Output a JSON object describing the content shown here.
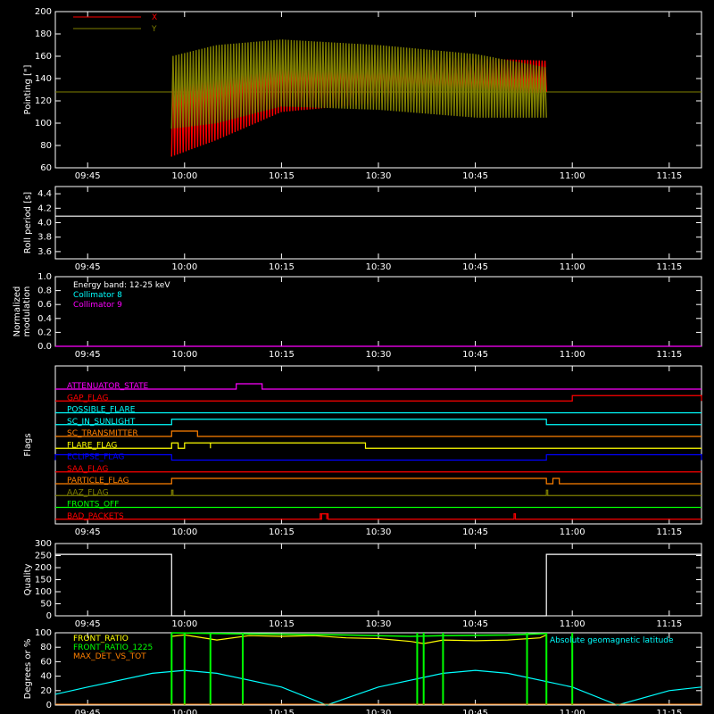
{
  "x_ticks": [
    "09:45",
    "10:00",
    "10:15",
    "10:30",
    "10:45",
    "11:00",
    "11:15"
  ],
  "chart_data": [
    {
      "type": "line",
      "ylabel": "Pointing [\"]",
      "ylim": [
        60,
        200
      ],
      "yticks": [
        60,
        80,
        100,
        120,
        140,
        160,
        180,
        200
      ],
      "legend": [
        {
          "name": "X",
          "color": "#ff0000"
        },
        {
          "name": "Y",
          "color": "#808000"
        }
      ],
      "series": [
        {
          "name": "X",
          "color": "#ff0000",
          "envelope": [
            {
              "t": "09:58",
              "lo": 70,
              "hi": 150
            },
            {
              "t": "10:05",
              "lo": 85,
              "hi": 155
            },
            {
              "t": "10:15",
              "lo": 110,
              "hi": 160
            },
            {
              "t": "10:30",
              "lo": 118,
              "hi": 160
            },
            {
              "t": "10:45",
              "lo": 120,
              "hi": 158
            },
            {
              "t": "10:56",
              "lo": 128,
              "hi": 156
            }
          ]
        },
        {
          "name": "Y",
          "color": "#808000",
          "envelope": [
            {
              "t": "09:58",
              "lo": 95,
              "hi": 160
            },
            {
              "t": "10:05",
              "lo": 100,
              "hi": 170
            },
            {
              "t": "10:15",
              "lo": 115,
              "hi": 175
            },
            {
              "t": "10:30",
              "lo": 112,
              "hi": 170
            },
            {
              "t": "10:45",
              "lo": 105,
              "hi": 162
            },
            {
              "t": "10:56",
              "lo": 105,
              "hi": 150
            }
          ],
          "baseline": 128
        }
      ]
    },
    {
      "type": "line",
      "ylabel": "Roll period [s]",
      "ylim": [
        3.5,
        4.5
      ],
      "yticks": [
        3.6,
        3.8,
        4.0,
        4.2,
        4.4
      ],
      "series": [
        {
          "name": "",
          "color": "#ffffff",
          "points": [
            {
              "t": "09:40",
              "y": 4.09
            },
            {
              "t": "11:20",
              "y": 4.09
            }
          ]
        }
      ]
    },
    {
      "type": "line",
      "ylabel_lines": [
        "Normalized",
        "modulation"
      ],
      "ylim": [
        0,
        1
      ],
      "yticks": [
        0.0,
        0.2,
        0.4,
        0.6,
        0.8,
        1.0
      ],
      "annotations": [
        {
          "text": "Energy band: 12-25 keV",
          "color": "#ffffff"
        },
        {
          "text": "Collimator 8",
          "color": "#00ffff"
        },
        {
          "text": "Collimator 9",
          "color": "#ff00ff"
        }
      ],
      "series": [
        {
          "name": "Collimator 9",
          "color": "#ff00ff",
          "points": [
            {
              "t": "09:40",
              "y": 0.0
            },
            {
              "t": "11:20",
              "y": 0.0
            }
          ]
        }
      ]
    },
    {
      "type": "line",
      "ylabel": "Flags",
      "flags": [
        {
          "name": "ATTENUATOR_STATE",
          "color": "#ff00ff",
          "on": [
            [
              "10:08",
              "10:12"
            ]
          ]
        },
        {
          "name": "GAP_FLAG",
          "color": "#ff0000",
          "on": [
            [
              "11:00",
              "11:20"
            ]
          ]
        },
        {
          "name": "POSSIBLE_FLARE",
          "color": "#00ffff",
          "on": []
        },
        {
          "name": "SC_IN_SUNLIGHT",
          "color": "#00ffff",
          "on": [
            [
              "09:58",
              "10:56"
            ]
          ]
        },
        {
          "name": "SC_TRANSMITTER",
          "color": "#ff8000",
          "on": [
            [
              "09:58",
              "10:02"
            ]
          ]
        },
        {
          "name": "FLARE_FLAG",
          "color": "#ffff00",
          "on": [
            [
              "09:58",
              "09:59"
            ],
            [
              "10:00",
              "10:04"
            ],
            [
              "10:04",
              "10:28"
            ]
          ]
        },
        {
          "name": "ECLIPSE_FLAG",
          "color": "#0000ff",
          "on": [
            [
              "09:40",
              "09:58"
            ],
            [
              "10:56",
              "11:20"
            ]
          ]
        },
        {
          "name": "SAA_FLAG",
          "color": "#ff0000",
          "on": []
        },
        {
          "name": "PARTICLE_FLAG",
          "color": "#ff8000",
          "on": [
            [
              "09:58",
              "10:56"
            ],
            [
              "10:57",
              "10:58"
            ]
          ]
        },
        {
          "name": "AAZ_FLAG",
          "color": "#808000",
          "on": [
            [
              "09:58",
              "09:58"
            ],
            [
              "10:56",
              "10:56"
            ]
          ]
        },
        {
          "name": "FRONTS_OFF",
          "color": "#00ff00",
          "on": []
        },
        {
          "name": "BAD_PACKETS",
          "color": "#ff0000",
          "on": [
            [
              "10:21",
              "10:21"
            ],
            [
              "10:21",
              "10:22"
            ],
            [
              "10:22",
              "10:22"
            ],
            [
              "10:51",
              "10:51"
            ]
          ]
        }
      ]
    },
    {
      "type": "line",
      "ylabel": "Quality",
      "ylim": [
        0,
        300
      ],
      "yticks": [
        0,
        50,
        100,
        150,
        200,
        250,
        300
      ],
      "series": [
        {
          "name": "",
          "color": "#ffffff",
          "points": [
            {
              "t": "09:40",
              "y": 255
            },
            {
              "t": "09:58",
              "y": 255
            },
            {
              "t": "09:58",
              "y": 0
            },
            {
              "t": "10:56",
              "y": 0
            },
            {
              "t": "10:56",
              "y": 255
            },
            {
              "t": "11:20",
              "y": 255
            }
          ]
        }
      ]
    },
    {
      "type": "line",
      "ylabel": "Degrees or %",
      "ylim": [
        0,
        100
      ],
      "yticks": [
        0,
        20,
        40,
        60,
        80,
        100
      ],
      "legend": [
        {
          "name": "FRONT_RATIO",
          "color": "#ffff00"
        },
        {
          "name": "FRONT_RATIO_1225",
          "color": "#00ff00"
        },
        {
          "name": "MAX_DET_VS_TOT",
          "color": "#ff8000"
        },
        {
          "name": "Absolute geomagnetic latitude",
          "color": "#00ffff"
        }
      ],
      "series": [
        {
          "name": "Absolute geomagnetic latitude",
          "color": "#00ffff",
          "points": [
            {
              "t": "09:40",
              "y": 15
            },
            {
              "t": "09:45",
              "y": 25
            },
            {
              "t": "09:55",
              "y": 44
            },
            {
              "t": "10:00",
              "y": 48
            },
            {
              "t": "10:05",
              "y": 44
            },
            {
              "t": "10:15",
              "y": 25
            },
            {
              "t": "10:22",
              "y": 0
            },
            {
              "t": "10:30",
              "y": 25
            },
            {
              "t": "10:40",
              "y": 44
            },
            {
              "t": "10:45",
              "y": 48
            },
            {
              "t": "10:50",
              "y": 44
            },
            {
              "t": "11:00",
              "y": 25
            },
            {
              "t": "11:07",
              "y": 0
            },
            {
              "t": "11:15",
              "y": 20
            },
            {
              "t": "11:20",
              "y": 25
            }
          ]
        },
        {
          "name": "FRONT_RATIO",
          "color": "#ffff00",
          "points": [
            {
              "t": "09:58",
              "y": 95
            },
            {
              "t": "10:00",
              "y": 97
            },
            {
              "t": "10:05",
              "y": 90
            },
            {
              "t": "10:10",
              "y": 96
            },
            {
              "t": "10:15",
              "y": 95
            },
            {
              "t": "10:20",
              "y": 96
            },
            {
              "t": "10:25",
              "y": 93
            },
            {
              "t": "10:30",
              "y": 92
            },
            {
              "t": "10:35",
              "y": 88
            },
            {
              "t": "10:37",
              "y": 85
            },
            {
              "t": "10:40",
              "y": 90
            },
            {
              "t": "10:45",
              "y": 89
            },
            {
              "t": "10:50",
              "y": 90
            },
            {
              "t": "10:55",
              "y": 93
            },
            {
              "t": "10:56",
              "y": 97
            }
          ]
        },
        {
          "name": "FRONT_RATIO_1225",
          "color": "#00ff00",
          "points": [
            {
              "t": "09:58",
              "y": 100
            },
            {
              "t": "10:05",
              "y": 99
            },
            {
              "t": "10:15",
              "y": 98
            },
            {
              "t": "10:25",
              "y": 97
            },
            {
              "t": "10:35",
              "y": 95
            },
            {
              "t": "10:40",
              "y": 96
            },
            {
              "t": "10:50",
              "y": 97
            },
            {
              "t": "10:56",
              "y": 99
            }
          ],
          "spikes": [
            "09:58",
            "10:00",
            "10:04",
            "10:09",
            "10:36",
            "10:37",
            "10:40",
            "10:53",
            "10:56",
            "11:00"
          ]
        }
      ]
    }
  ]
}
